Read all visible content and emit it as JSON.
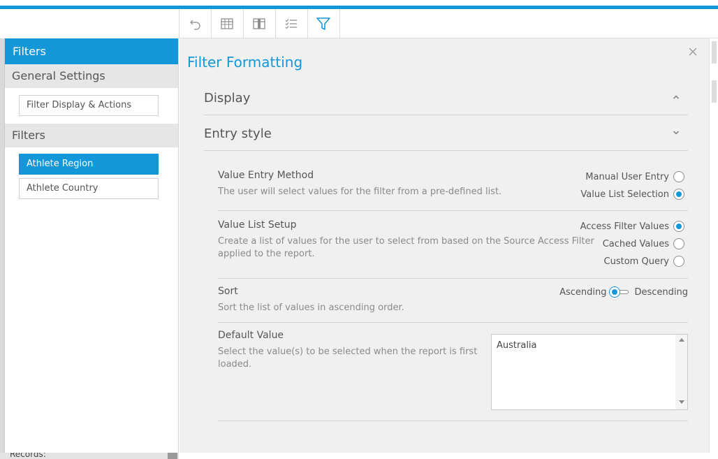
{
  "toolbar": {
    "items": [
      {
        "icon": "undo-icon"
      },
      {
        "icon": "table-icon"
      },
      {
        "icon": "columns-icon"
      },
      {
        "icon": "checklist-icon"
      },
      {
        "icon": "filter-icon"
      }
    ]
  },
  "sidebar": {
    "title": "Filters",
    "general_heading": "General Settings",
    "general_items": [
      "Filter Display & Actions"
    ],
    "filters_heading": "Filters",
    "filter_items": [
      {
        "label": "Athlete Region",
        "active": true
      },
      {
        "label": "Athlete Country",
        "active": false
      }
    ]
  },
  "bottom": {
    "records_label": "Records:"
  },
  "panel": {
    "title": "Filter Formatting",
    "sections": [
      {
        "label": "Display",
        "expanded": false
      },
      {
        "label": "Entry style",
        "expanded": true
      }
    ],
    "value_entry": {
      "title": "Value Entry Method",
      "desc": "The user will select values for the filter from a pre-defined list.",
      "options": [
        {
          "label": "Manual User Entry",
          "selected": false
        },
        {
          "label": "Value List Selection",
          "selected": true
        }
      ]
    },
    "value_list_setup": {
      "title": "Value List Setup",
      "desc_line1": "Create a list of values for the user to select from based on the Source Access Filter",
      "desc_line2": "applied to the report.",
      "options": [
        {
          "label": "Access Filter Values",
          "selected": true
        },
        {
          "label": "Cached Values",
          "selected": false
        },
        {
          "label": "Custom Query",
          "selected": false
        }
      ]
    },
    "sort": {
      "title": "Sort",
      "desc": "Sort the list of values in ascending order.",
      "left_label": "Ascending",
      "right_label": "Descending",
      "value": "Ascending"
    },
    "default_value": {
      "title": "Default Value",
      "desc_line1": "Select the value(s) to be selected when the report is first",
      "desc_line2": "loaded.",
      "selected_value": "Australia"
    }
  },
  "colors": {
    "accent": "#1497d9",
    "panel_bg": "#f0f0f0"
  }
}
